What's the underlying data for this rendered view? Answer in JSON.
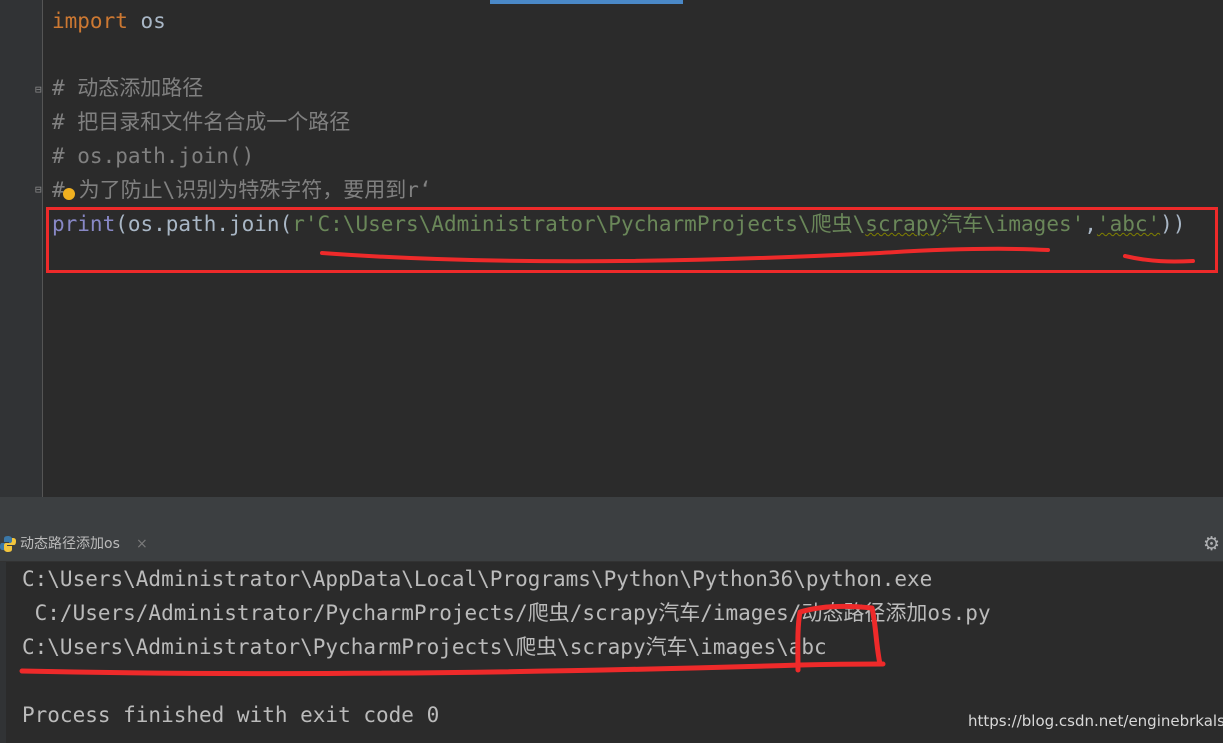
{
  "editor": {
    "lines": {
      "import_kw": "import",
      "import_mod": " os",
      "comment1": "# 动态添加路径",
      "comment2": "# 把目录和文件名合成一个路径",
      "comment3": "# os.path.join()",
      "comment4_hash": "#",
      "comment4_text": "为了防止\\识别为特殊字符，要用到r‘",
      "print_fn": "print",
      "print_call": "(os.path.join(",
      "print_str1_pre": "r'C:\\Users\\Administrator\\PycharmProjects\\爬虫\\",
      "print_str1_word": "scrapy",
      "print_str1_post": "汽车\\images'",
      "print_comma": ",",
      "print_str2": "'abc'",
      "print_close": "))"
    }
  },
  "run_panel": {
    "tab_label": "动态路径添加os",
    "tab_close": "×",
    "gear": "⚙"
  },
  "console": {
    "line1": "C:\\Users\\Administrator\\AppData\\Local\\Programs\\Python\\Python36\\python.exe",
    "line2": " C:/Users/Administrator/PycharmProjects/爬虫/scrapy汽车/images/动态路径添加os.py",
    "line3": "C:\\Users\\Administrator\\PycharmProjects\\爬虫\\scrapy汽车\\images\\abc",
    "line4": "Process finished with exit code 0"
  },
  "watermark": "https://blog.csdn.net/enginebrkalsy",
  "colors": {
    "background": "#2b2b2b",
    "keyword": "#cc7832",
    "string": "#6a8759",
    "comment": "#808080",
    "builtin": "#8888c6",
    "annotation": "#ee2a2a"
  }
}
